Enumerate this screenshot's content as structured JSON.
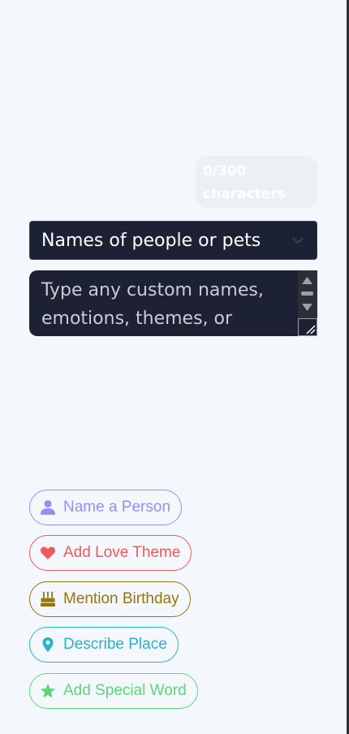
{
  "counter": {
    "text": "0/300 characters"
  },
  "category_select": {
    "selected": "Names of people or pets"
  },
  "custom_input": {
    "placeholder": "Type any custom names, emotions, themes, or words",
    "value": ""
  },
  "suggestions": [
    {
      "label": "Name a Person",
      "icon": "person-icon",
      "color": "#9b8cf5"
    },
    {
      "label": "Add Love Theme",
      "icon": "heart-icon",
      "color": "#ef5a5a"
    },
    {
      "label": "Mention Birthday",
      "icon": "birthday-cake-icon",
      "color": "#94760c"
    },
    {
      "label": "Describe Place",
      "icon": "map-pin-icon",
      "color": "#26b3cf"
    },
    {
      "label": "Add Special Word",
      "icon": "star-icon",
      "color": "#5cd67a"
    }
  ]
}
